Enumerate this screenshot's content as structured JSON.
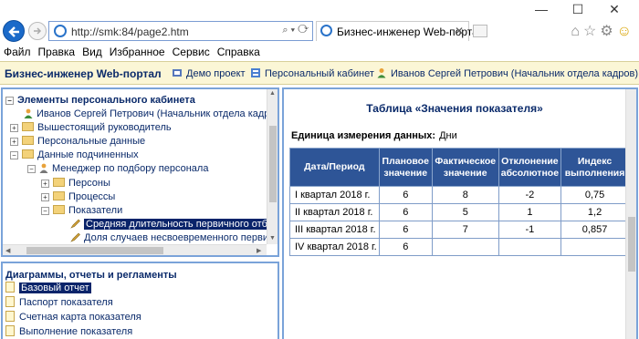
{
  "browser": {
    "url": "http://smk:84/page2.htm",
    "tab_title": "Бизнес-инженер Web-портал",
    "window_controls": {
      "minimize": "—",
      "maximize": "☐",
      "close": "✕"
    },
    "toolbar_icons": [
      "home-icon",
      "star-icon",
      "gear-icon",
      "smiley-icon"
    ],
    "menu": [
      "Файл",
      "Правка",
      "Вид",
      "Избранное",
      "Сервис",
      "Справка"
    ]
  },
  "portal": {
    "title": "Бизнес-инженер Web-портал",
    "links": [
      "Демо проект",
      "Персональный кабинет",
      "Иванов Сергей Петрович (Начальник отдела кадров)"
    ]
  },
  "personal_pane": {
    "header": "Элементы персонального кабинета",
    "tree": [
      {
        "label": "Иванов Сергей Петрович (Начальник отдела кадров)",
        "icon": "person",
        "level": 1,
        "expander": ""
      },
      {
        "label": "Вышестоящий руководитель",
        "icon": "folder",
        "level": 0,
        "expander": "+"
      },
      {
        "label": "Персональные данные",
        "icon": "folder",
        "level": 0,
        "expander": "+"
      },
      {
        "label": "Данные подчиненных",
        "icon": "folder",
        "level": 0,
        "expander": "−"
      },
      {
        "label": "Менеджер по подбору персонала",
        "icon": "person",
        "level": 1,
        "expander": "−"
      },
      {
        "label": "Персоны",
        "icon": "folder",
        "level": 2,
        "expander": "+"
      },
      {
        "label": "Процессы",
        "icon": "folder",
        "level": 2,
        "expander": "+"
      },
      {
        "label": "Показатели",
        "icon": "folder",
        "level": 2,
        "expander": "−"
      },
      {
        "label": "Средняя длительность первичного отбора",
        "icon": "pencil",
        "level": 3,
        "expander": "",
        "selected": true
      },
      {
        "label": "Доля случаев несвоевременного первичного",
        "icon": "pencil",
        "level": 3,
        "expander": ""
      }
    ]
  },
  "reports_pane": {
    "header": "Диаграммы, отчеты и регламенты",
    "items": [
      {
        "label": "Базовый отчет",
        "selected": true
      },
      {
        "label": "Паспорт показателя",
        "selected": false
      },
      {
        "label": "Счетная карта показателя",
        "selected": false
      },
      {
        "label": "Выполнение показателя",
        "selected": false
      }
    ]
  },
  "indicator_table": {
    "title": "Таблица «Значения показателя»",
    "unit_label": "Единица измерения данных:",
    "unit_value": "Дни",
    "columns": [
      "Дата/Период",
      "Плановое значение",
      "Фактическое значение",
      "Отклонение абсолютное",
      "Индекс выполнения"
    ],
    "rows": [
      [
        "I квартал 2018 г.",
        "6",
        "8",
        "-2",
        "0,75"
      ],
      [
        "II квартал 2018 г.",
        "6",
        "5",
        "1",
        "1,2"
      ],
      [
        "III квартал 2018 г.",
        "6",
        "7",
        "-1",
        "0,857"
      ],
      [
        "IV квартал 2018 г.",
        "6",
        "",
        "",
        ""
      ]
    ]
  }
}
